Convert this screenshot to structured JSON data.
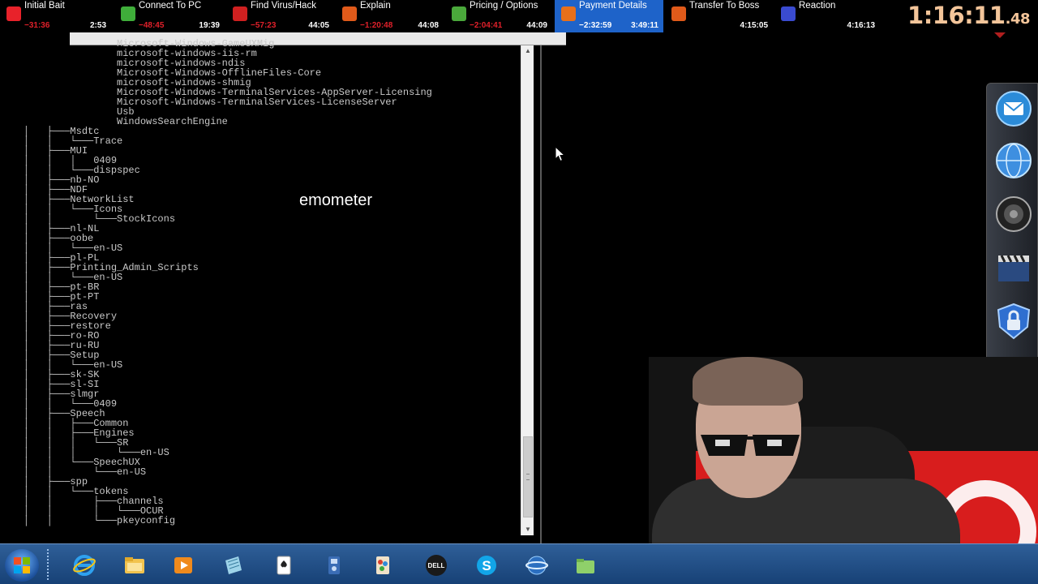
{
  "splits": [
    {
      "name": "Initial Bait",
      "delta": "−31:36",
      "time": "2:53",
      "icon": "flag-icon",
      "color": "#e8222a"
    },
    {
      "name": "Connect To PC",
      "delta": "−48:45",
      "time": "19:39",
      "icon": "shield-icon",
      "color": "#3fae3a"
    },
    {
      "name": "Find Virus/Hack",
      "delta": "−57:23",
      "time": "44:05",
      "icon": "virus-icon",
      "color": "#d02020"
    },
    {
      "name": "Explain",
      "delta": "−1:20:48",
      "time": "44:08",
      "icon": "envelope-icon",
      "color": "#e05a1a"
    },
    {
      "name": "Pricing / Options",
      "delta": "−2:04:41",
      "time": "44:09",
      "icon": "money-icon",
      "color": "#4aa83b"
    },
    {
      "name": "Payment Details",
      "delta": "−2:32:59",
      "time": "3:49:11",
      "icon": "card-icon",
      "color": "#e8701a"
    },
    {
      "name": "Transfer To Boss",
      "delta": "",
      "time": "4:15:05",
      "icon": "envelope-icon",
      "color": "#e05a1a"
    },
    {
      "name": "Reaction",
      "delta": "",
      "time": "4:16:13",
      "icon": "face-icon",
      "color": "#3a4bd0"
    }
  ],
  "active_split_index": 5,
  "timer": {
    "main": "1:16:11",
    "fraction": ".48"
  },
  "console": {
    "lines": [
      "                    Microsoft-Windows-GameUXMig",
      "                    microsoft-windows-iis-rm",
      "                    microsoft-windows-ndis",
      "                    Microsoft-Windows-OfflineFiles-Core",
      "                    microsoft-windows-shmig",
      "                    Microsoft-Windows-TerminalServices-AppServer-Licensing",
      "                    Microsoft-Windows-TerminalServices-LicenseServer",
      "                    Usb",
      "                    WindowsSearchEngine",
      "    │   ├───Msdtc",
      "    │   │   └───Trace",
      "    │   ├───MUI",
      "    │   │   │   0409",
      "    │   │   └───dispspec",
      "    │   ├───nb-NO",
      "    │   ├───NDF",
      "    │   ├───NetworkList",
      "    │   │   └───Icons",
      "    │   │       └───StockIcons",
      "    │   ├───nl-NL",
      "    │   ├───oobe",
      "    │   │   └───en-US",
      "    │   ├───pl-PL",
      "    │   ├───Printing_Admin_Scripts",
      "    │   │   └───en-US",
      "    │   ├───pt-BR",
      "    │   ├───pt-PT",
      "    │   ├───ras",
      "    │   ├───Recovery",
      "    │   ├───restore",
      "    │   ├───ro-RO",
      "    │   ├───ru-RU",
      "    │   ├───Setup",
      "    │   │   └───en-US",
      "    │   ├───sk-SK",
      "    │   ├───sl-SI",
      "    │   ├───slmgr",
      "    │   │   └───0409",
      "    │   ├───Speech",
      "    │   │   ├───Common",
      "    │   │   ├───Engines",
      "    │   │   │   └───SR",
      "    │   │   │       └───en-US",
      "    │   │   └───SpeechUX",
      "    │   │       └───en-US",
      "    │   ├───spp",
      "    │   │   └───tokens",
      "    │   │       ├───channels",
      "    │   │       │   └───OCUR",
      "    │   │       └───pkeyconfig"
    ]
  },
  "dock": {
    "icons": [
      "mail-icon",
      "globe-icon",
      "speaker-icon",
      "clapperboard-icon",
      "lock-icon",
      "help-icon",
      "trash-icon"
    ]
  },
  "webcam": {
    "overlay_text": "emometer"
  },
  "taskbar": {
    "icons": [
      "windows-start-icon",
      "internet-explorer-icon",
      "file-explorer-icon",
      "media-player-icon",
      "notepad-icon",
      "solitaire-icon",
      "system-settings-icon",
      "paint-icon",
      "dell-icon",
      "skype-icon",
      "network-icon",
      "folder-icon"
    ]
  }
}
